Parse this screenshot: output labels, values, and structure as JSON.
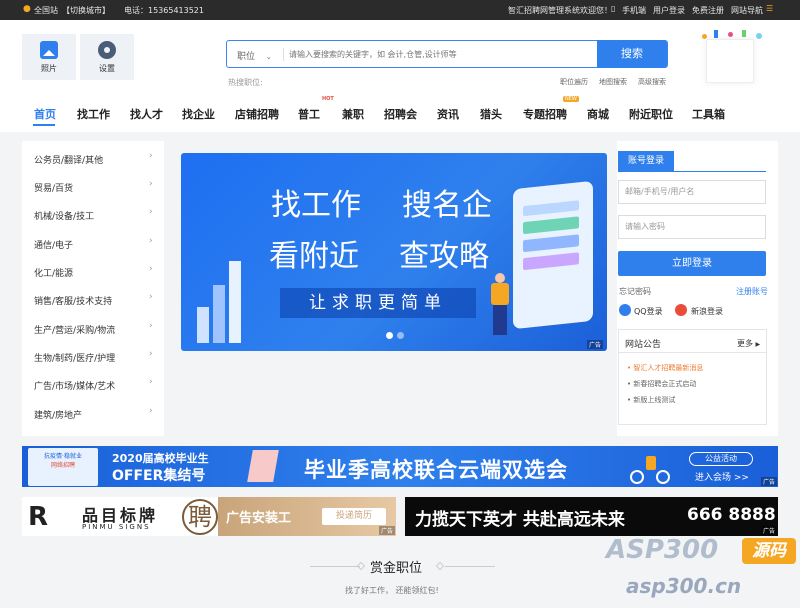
{
  "topbar": {
    "site": "全国站",
    "switch_city": "【切换城市】",
    "phone": "电话：15365413521",
    "welcome": "智汇招聘网管理系统欢迎您！",
    "mobile": "手机端",
    "login": "用户登录",
    "register": "免费注册",
    "sitenav": "网站导航"
  },
  "quick": {
    "photo": "照片",
    "settings": "设置"
  },
  "search": {
    "type": "职位",
    "placeholder": "请输入要搜索的关键字，如 会计,仓管,设计师等",
    "button": "搜索",
    "hot_label": "热搜职位:",
    "links": [
      "职位遍历",
      "地图搜索",
      "高级搜索"
    ]
  },
  "nav": {
    "items": [
      "首页",
      "找工作",
      "找人才",
      "找企业",
      "店铺招聘",
      "普工",
      "兼职",
      "招聘会",
      "资讯",
      "猎头",
      "专题招聘",
      "商城",
      "附近职位",
      "工具箱"
    ],
    "hot_tag": "HOT",
    "new_tag": "NEW"
  },
  "categories": [
    "公务员/翻译/其他",
    "贸易/百货",
    "机械/设备/技工",
    "通信/电子",
    "化工/能源",
    "销售/客服/技术支持",
    "生产/营运/采购/物流",
    "生物/制药/医疗/护理",
    "广告/市场/媒体/艺术",
    "建筑/房地产"
  ],
  "hero": {
    "line1a": "找工作",
    "line1b": "搜名企",
    "line2a": "看附近",
    "line2b": "查攻略",
    "slogan": "让求职更简单",
    "ad": "广告"
  },
  "login": {
    "tab": "账号登录",
    "user_placeholder": "邮箱/手机号/用户名",
    "pass_placeholder": "请输入密码",
    "submit": "立即登录",
    "forgot": "忘记密码",
    "register": "注册账号",
    "qq": "QQ登录",
    "weibo": "新浪登录"
  },
  "notice": {
    "title": "网站公告",
    "more": "更多",
    "items": [
      "智汇人才招聘最新消息",
      "新春招聘会正式启动",
      "新版上线测试"
    ]
  },
  "banner1": {
    "badge1": "抗疫情·稳就业",
    "badge2": "网络招聘",
    "year": "2020届高校毕业生",
    "offer": "OFFER集结号",
    "main": "毕业季高校联合云端双选会",
    "activity": "公益活动",
    "enter": "进入会场 >>",
    "ad": "广告"
  },
  "banner2": {
    "brand_cn": "品目标牌",
    "brand_en": "PINMU SIGNS",
    "seal": "聘",
    "job": "广告安装工",
    "apply": "投递简历",
    "ad": "广告"
  },
  "banner3": {
    "text": "力揽天下英才 共赴高远未来",
    "phone": "666 8888",
    "ad": "广告"
  },
  "reward": {
    "title": "赏金职位",
    "subtitle": "找了好工作， 还能领红包!"
  },
  "watermark": {
    "brand": "ASP300",
    "tag": "源码",
    "domain": "asp300.cn"
  }
}
